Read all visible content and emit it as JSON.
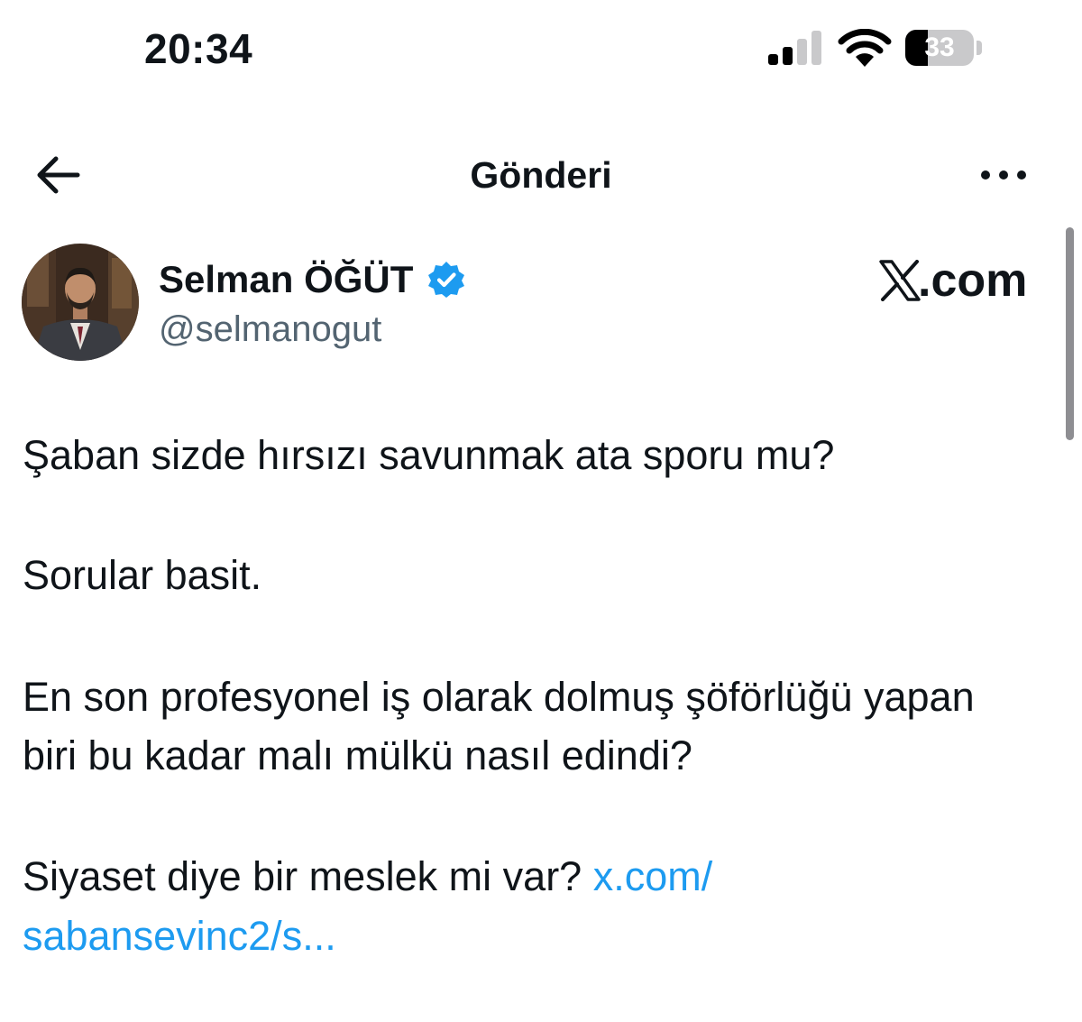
{
  "status_bar": {
    "time": "20:34",
    "battery_percent": "33",
    "battery_level": 0.33,
    "signal_bars_active": 2,
    "signal_bars_total": 4
  },
  "header": {
    "title": "Gönderi",
    "back_icon": "arrow-left-icon",
    "more_icon": "ellipsis-icon"
  },
  "author": {
    "name": "Selman ÖĞÜT",
    "handle": "@selmanogut",
    "verified": true,
    "verified_color": "#1d9bf0"
  },
  "watermark": {
    "domain": ".com",
    "logo": "x-logo"
  },
  "tweet": {
    "line1": "Şaban sizde hırsızı savunmak ata sporu mu?",
    "line2": "Sorular basit.",
    "line3": "En son profesyonel iş olarak dolmuş şöförlüğü yapan",
    "line4": "biri bu kadar malı mülkü nasıl edindi?",
    "line5": "Siyaset diye bir meslek mi var? ",
    "link_part1": "x.com/",
    "link_part2": "sabansevinc2/s..."
  },
  "colors": {
    "text": "#0f1419",
    "secondary": "#536471",
    "link": "#1d9bf0"
  }
}
